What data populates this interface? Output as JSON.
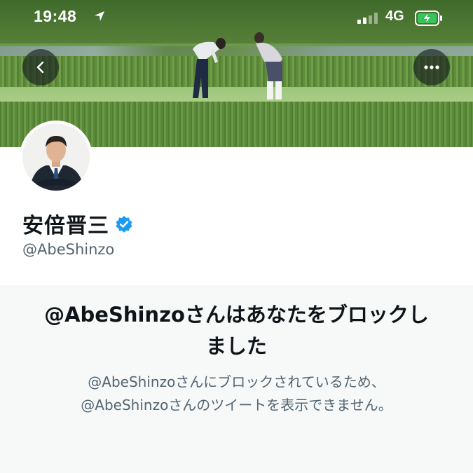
{
  "status_bar": {
    "time": "19:48",
    "network": "4G"
  },
  "header": {
    "back_icon": "chevron-left-icon",
    "more_icon": "more-horizontal-icon"
  },
  "profile": {
    "display_name": "安倍晋三",
    "handle": "@AbeShinzo",
    "verified_color": "#1d9bf0"
  },
  "blocked_notice": {
    "title_line1": "@AbeShinzoさんはあなたをブロックし",
    "title_line2": "ました",
    "description_line1": "@AbeShinzoさんにブロックされているため、",
    "description_line2": "@AbeShinzoさんのツイートを表示できません。"
  },
  "colors": {
    "text_primary": "#0f1419",
    "text_secondary": "#536471",
    "panel_bg": "#f7f9f9"
  }
}
